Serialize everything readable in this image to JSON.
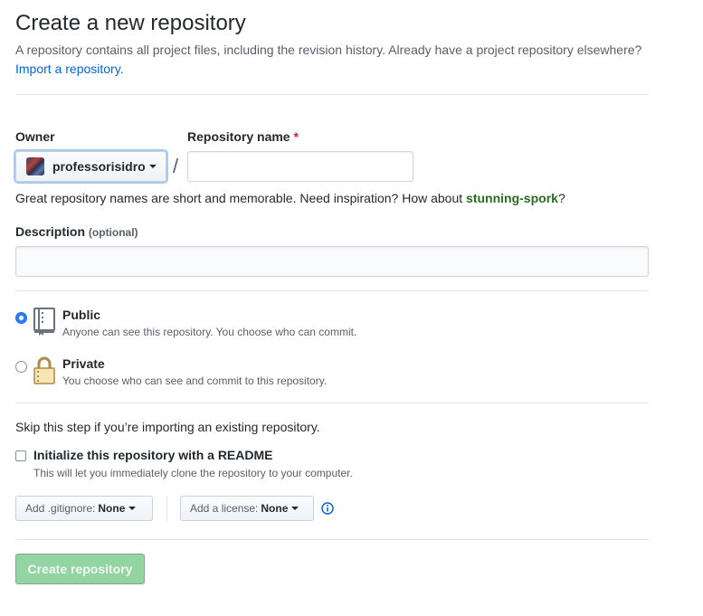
{
  "header": {
    "title": "Create a new repository",
    "subtitle_prefix": "A repository contains all project files, including the revision history. Already have a project repository elsewhere?",
    "import_link": "Import a repository."
  },
  "owner": {
    "label": "Owner",
    "value": "professorisidro"
  },
  "repo_name": {
    "label": "Repository name",
    "required_mark": "*",
    "value": "",
    "separator": "/"
  },
  "hint": {
    "prefix": "Great repository names are short and memorable. Need inspiration? How about",
    "suggestion": "stunning-spork",
    "suffix": "?"
  },
  "description": {
    "label": "Description",
    "optional": "(optional)",
    "value": ""
  },
  "visibility": {
    "selected": "public",
    "options": [
      {
        "id": "public",
        "title": "Public",
        "desc": "Anyone can see this repository. You choose who can commit."
      },
      {
        "id": "private",
        "title": "Private",
        "desc": "You choose who can see and commit to this repository."
      }
    ]
  },
  "init": {
    "skip_text": "Skip this step if you’re importing an existing repository.",
    "readme_title": "Initialize this repository with a README",
    "readme_desc": "This will let you immediately clone the repository to your computer.",
    "readme_checked": false
  },
  "selects": {
    "gitignore_label": "Add .gitignore:",
    "gitignore_value": "None",
    "license_label": "Add a license:",
    "license_value": "None"
  },
  "submit": {
    "label": "Create repository",
    "enabled": false
  },
  "colors": {
    "link": "#0366d6",
    "suggestion": "#2c6b1f",
    "required": "#cb2431",
    "create_disabled_bg": "#94d3a2",
    "radio_selected": "#2d7ff9"
  }
}
